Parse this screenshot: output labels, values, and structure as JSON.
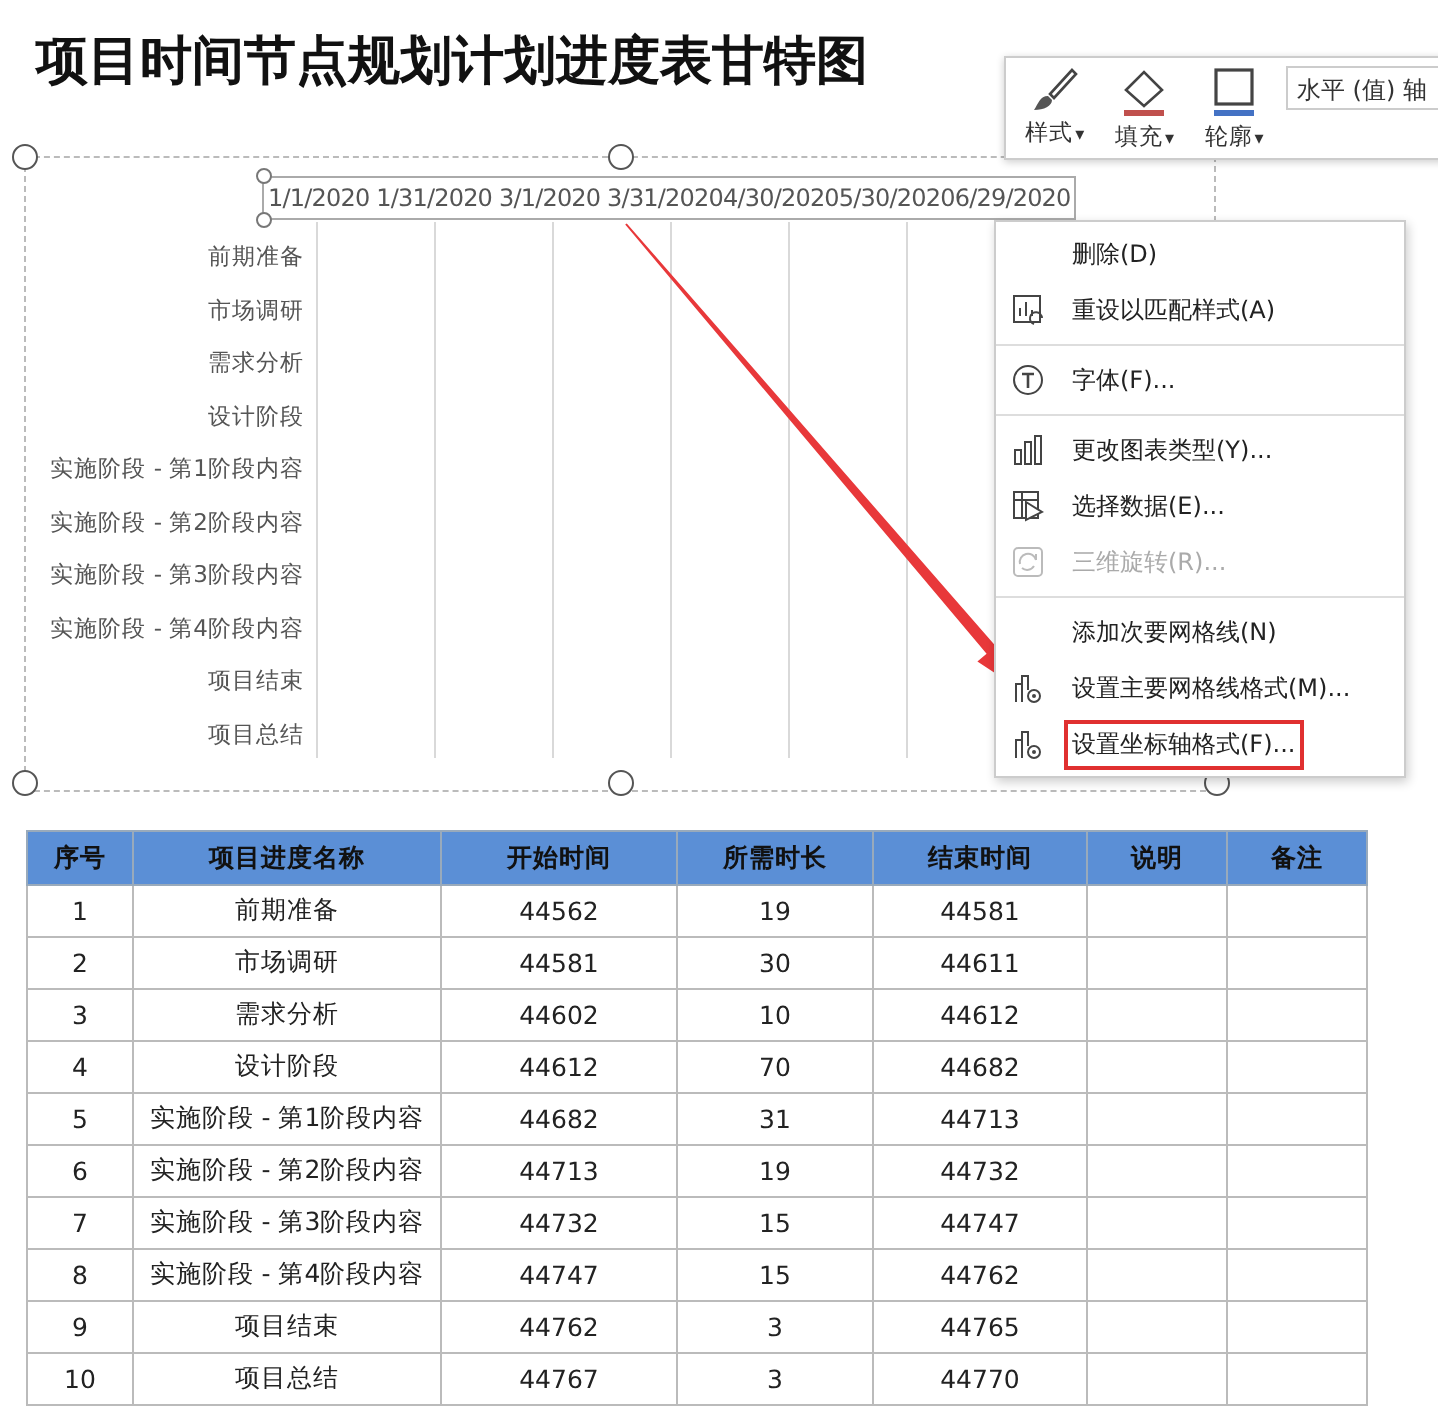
{
  "title": "项目时间节点规划计划进度表甘特图",
  "chart": {
    "axis_label": "1/1/2020 1/31/2020 3/1/2020 3/31/20204/30/20205/30/20206/29/2020",
    "categories": [
      "前期准备",
      "市场调研",
      "需求分析",
      "设计阶段",
      "实施阶段 - 第1阶段内容",
      "实施阶段 - 第2阶段内容",
      "实施阶段 - 第3阶段内容",
      "实施阶段 - 第4阶段内容",
      "项目结束",
      "项目总结"
    ]
  },
  "format_toolbar": {
    "buttons": [
      {
        "label": "样式",
        "caret": "▾"
      },
      {
        "label": "填充",
        "caret": "▾"
      },
      {
        "label": "轮廓",
        "caret": "▾"
      }
    ],
    "element_field": "水平 (值) 轴"
  },
  "context_menu": {
    "groups": [
      [
        {
          "label": "删除(D)",
          "disabled": false,
          "highlighted": false
        },
        {
          "label": "重设以匹配样式(A)",
          "disabled": false,
          "highlighted": false
        }
      ],
      [
        {
          "label": "字体(F)...",
          "disabled": false,
          "highlighted": false
        }
      ],
      [
        {
          "label": "更改图表类型(Y)...",
          "disabled": false,
          "highlighted": false
        },
        {
          "label": "选择数据(E)...",
          "disabled": false,
          "highlighted": false
        },
        {
          "label": "三维旋转(R)...",
          "disabled": true,
          "highlighted": false
        }
      ],
      [
        {
          "label": "添加次要网格线(N)",
          "disabled": false,
          "highlighted": false
        },
        {
          "label": "设置主要网格线格式(M)...",
          "disabled": false,
          "highlighted": false
        },
        {
          "label": "设置坐标轴格式(F)...",
          "disabled": false,
          "highlighted": true
        }
      ]
    ]
  },
  "table": {
    "columns": [
      "序号",
      "项目进度名称",
      "开始时间",
      "所需时长",
      "结束时间",
      "说明",
      "备注"
    ],
    "rows": [
      [
        "1",
        "前期准备",
        "44562",
        "19",
        "44581"
      ],
      [
        "2",
        "市场调研",
        "44581",
        "30",
        "44611"
      ],
      [
        "3",
        "需求分析",
        "44602",
        "10",
        "44612"
      ],
      [
        "4",
        "设计阶段",
        "44612",
        "70",
        "44682"
      ],
      [
        "5",
        "实施阶段 - 第1阶段内容",
        "44682",
        "31",
        "44713"
      ],
      [
        "6",
        "实施阶段 - 第2阶段内容",
        "44713",
        "19",
        "44732"
      ],
      [
        "7",
        "实施阶段 - 第3阶段内容",
        "44732",
        "15",
        "44747"
      ],
      [
        "8",
        "实施阶段 - 第4阶段内容",
        "44747",
        "15",
        "44762"
      ],
      [
        "9",
        "项目结束",
        "44762",
        "3",
        "44765"
      ],
      [
        "10",
        "项目总结",
        "44767",
        "3",
        "44770"
      ]
    ]
  }
}
